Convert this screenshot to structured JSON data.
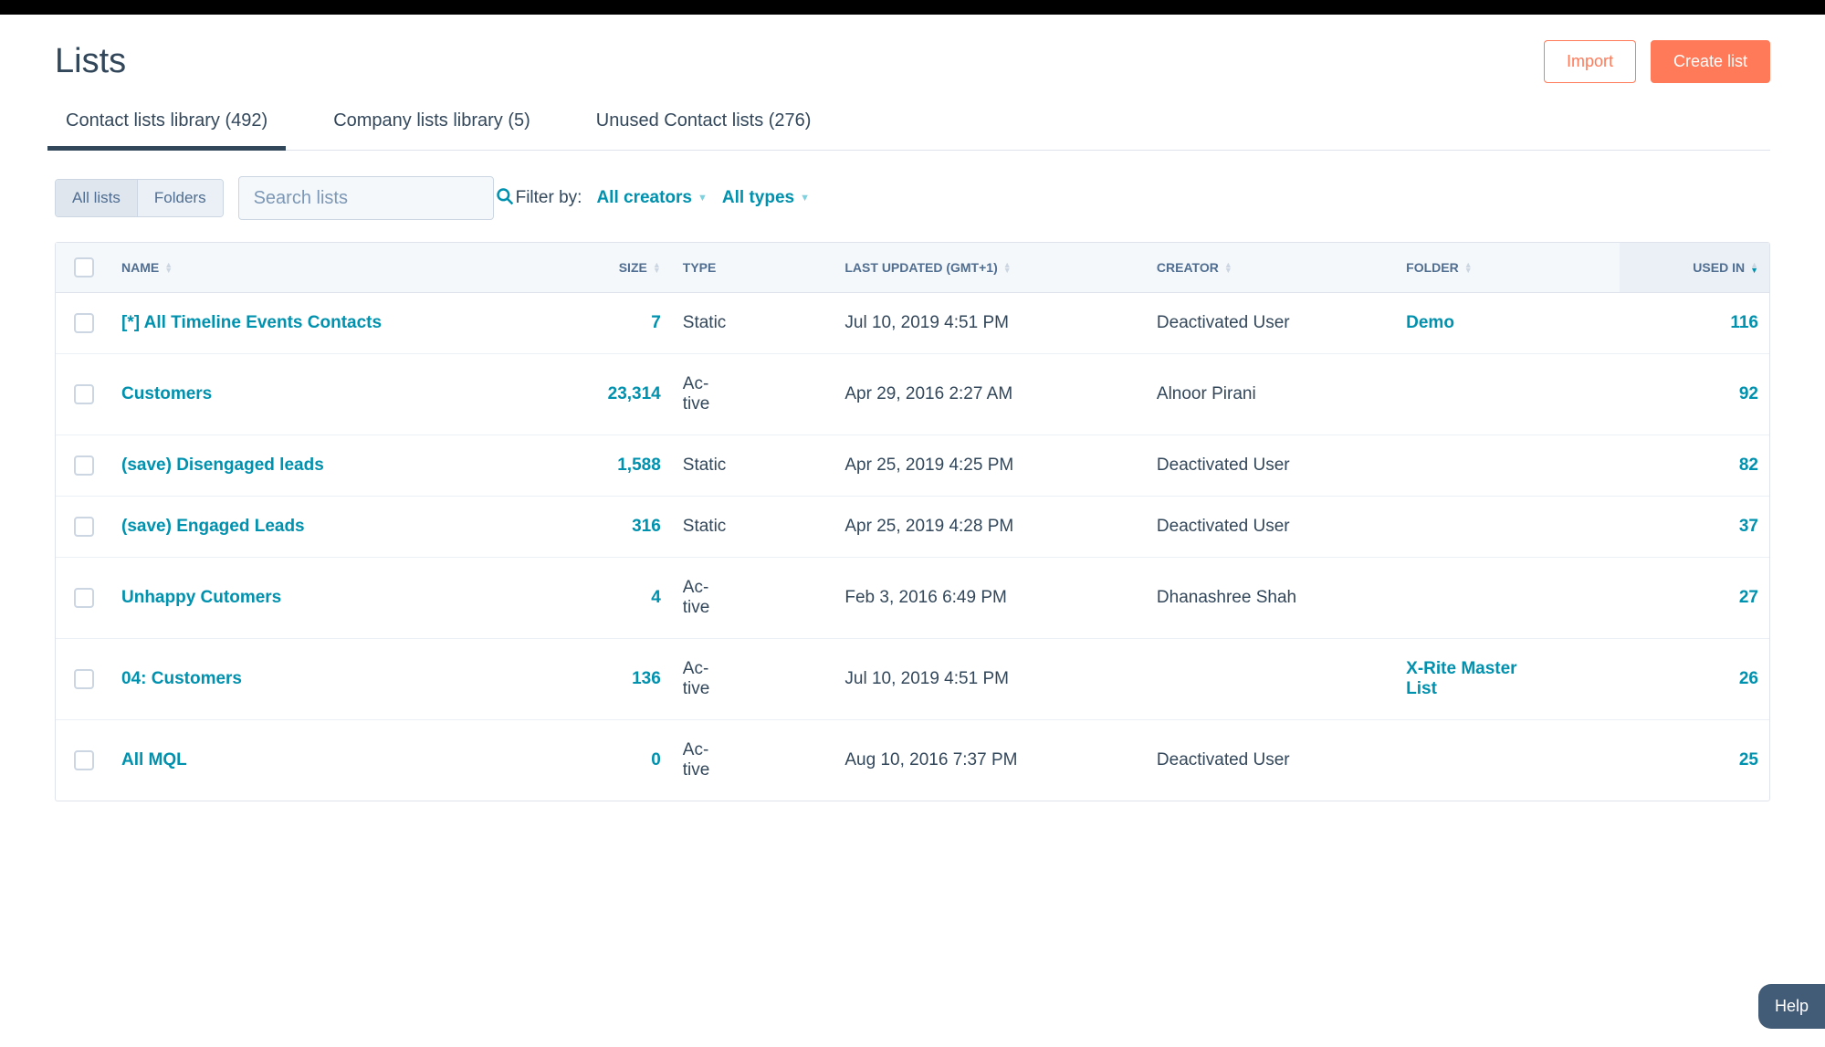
{
  "page_title": "Lists",
  "header": {
    "import_label": "Import",
    "create_label": "Create list"
  },
  "tabs": [
    {
      "label": "Contact lists library (492)",
      "active": true
    },
    {
      "label": "Company lists library (5)",
      "active": false
    },
    {
      "label": "Unused Contact lists (276)",
      "active": false
    }
  ],
  "view_toggle": {
    "all_lists": "All lists",
    "folders": "Folders"
  },
  "search": {
    "placeholder": "Search lists"
  },
  "filter": {
    "label": "Filter by:",
    "creators": "All creators",
    "types": "All types"
  },
  "columns": {
    "name": "NAME",
    "size": "SIZE",
    "type": "TYPE",
    "last_updated": "LAST UPDATED (GMT+1)",
    "creator": "CREATOR",
    "folder": "FOLDER",
    "used_in": "USED IN"
  },
  "rows": [
    {
      "name": "[*] All Timeline Events Contacts",
      "size": "7",
      "type": "Static",
      "last_updated": "Jul 10, 2019 4:51 PM",
      "creator": "Deactivated User",
      "folder": "Demo",
      "used_in": "116"
    },
    {
      "name": "Customers",
      "size": "23,314",
      "type": "Active",
      "last_updated": "Apr 29, 2016 2:27 AM",
      "creator": "Alnoor Pirani",
      "folder": "",
      "used_in": "92"
    },
    {
      "name": "(save) Disengaged leads",
      "size": "1,588",
      "type": "Static",
      "last_updated": "Apr 25, 2019 4:25 PM",
      "creator": "Deactivated User",
      "folder": "",
      "used_in": "82"
    },
    {
      "name": "(save) Engaged Leads",
      "size": "316",
      "type": "Static",
      "last_updated": "Apr 25, 2019 4:28 PM",
      "creator": "Deactivated User",
      "folder": "",
      "used_in": "37"
    },
    {
      "name": "Unhappy Cutomers",
      "size": "4",
      "type": "Active",
      "last_updated": "Feb 3, 2016 6:49 PM",
      "creator": "Dhanashree Shah",
      "folder": "",
      "used_in": "27"
    },
    {
      "name": "04: Customers",
      "size": "136",
      "type": "Active",
      "last_updated": "Jul 10, 2019 4:51 PM",
      "creator": "",
      "folder": "X-Rite Master List",
      "used_in": "26"
    },
    {
      "name": "All MQL",
      "size": "0",
      "type": "Active",
      "last_updated": "Aug 10, 2016 7:37 PM",
      "creator": "Deactivated User",
      "folder": "",
      "used_in": "25"
    }
  ],
  "help_label": "Help"
}
